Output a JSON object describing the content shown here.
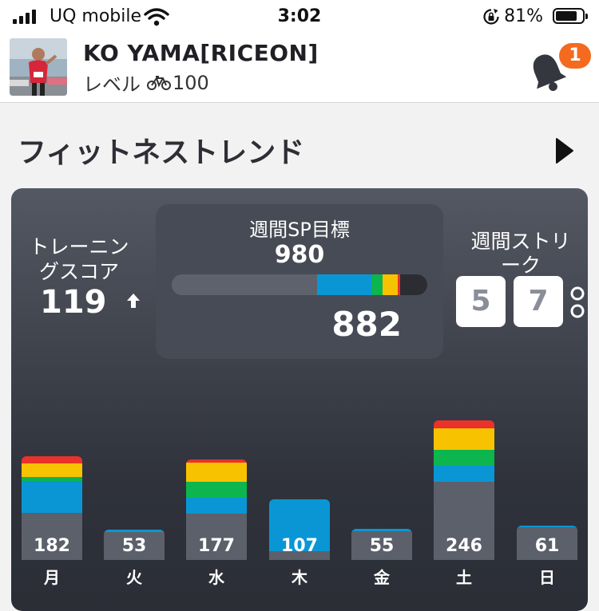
{
  "status_bar": {
    "carrier": "UQ mobile",
    "time": "3:02",
    "battery_percent": "81%",
    "battery_level": 0.81
  },
  "header": {
    "user_name": "KO YAMA[RICEON]",
    "level_label": "レベル",
    "level_value": "100",
    "notification_count": "1"
  },
  "section": {
    "title": "フィットネストレンド"
  },
  "training_score": {
    "label_line1": "トレーニン",
    "label_line2": "グスコア",
    "value": "119",
    "trend": "up"
  },
  "weekly_goal": {
    "label": "週間SP目標",
    "target": "980",
    "current": "882",
    "target_value": 980,
    "current_value": 882,
    "progress_segments": [
      {
        "zone": "gray",
        "color": "#5e626c",
        "share": 0.57
      },
      {
        "zone": "blue",
        "color": "#0a96d4",
        "share": 0.21
      },
      {
        "zone": "green",
        "color": "#0cb54d",
        "share": 0.045
      },
      {
        "zone": "yellow",
        "color": "#f7c200",
        "share": 0.06
      },
      {
        "zone": "red",
        "color": "#e8322a",
        "share": 0.01
      }
    ]
  },
  "weekly_streak": {
    "label_line1": "週間ストリ",
    "label_line2": "ーク",
    "digits": [
      "5",
      "7"
    ]
  },
  "colors": {
    "gray": "#5c606a",
    "blue": "#0a96d4",
    "green": "#0cb54d",
    "yellow": "#f7c200",
    "red": "#e8322a",
    "accent": "#f46a1f"
  },
  "chart_data": {
    "type": "bar",
    "categories": [
      "月",
      "火",
      "水",
      "木",
      "金",
      "土",
      "日"
    ],
    "values": [
      182,
      53,
      177,
      107,
      55,
      246,
      61
    ],
    "value_labels": [
      "182",
      "53",
      "177",
      "107",
      "55",
      "246",
      "61"
    ],
    "zone_order": [
      "gray",
      "blue",
      "green",
      "yellow",
      "red"
    ],
    "series": [
      {
        "zone": "gray",
        "values": [
          83,
          49,
          82,
          15,
          50,
          138,
          57
        ]
      },
      {
        "zone": "blue",
        "values": [
          56,
          4,
          28,
          92,
          5,
          28,
          4
        ]
      },
      {
        "zone": "green",
        "values": [
          7,
          0,
          28,
          0,
          0,
          28,
          0
        ]
      },
      {
        "zone": "yellow",
        "values": [
          24,
          0,
          33,
          0,
          0,
          38,
          0
        ]
      },
      {
        "zone": "red",
        "values": [
          12,
          0,
          6,
          0,
          0,
          14,
          0
        ]
      }
    ]
  }
}
